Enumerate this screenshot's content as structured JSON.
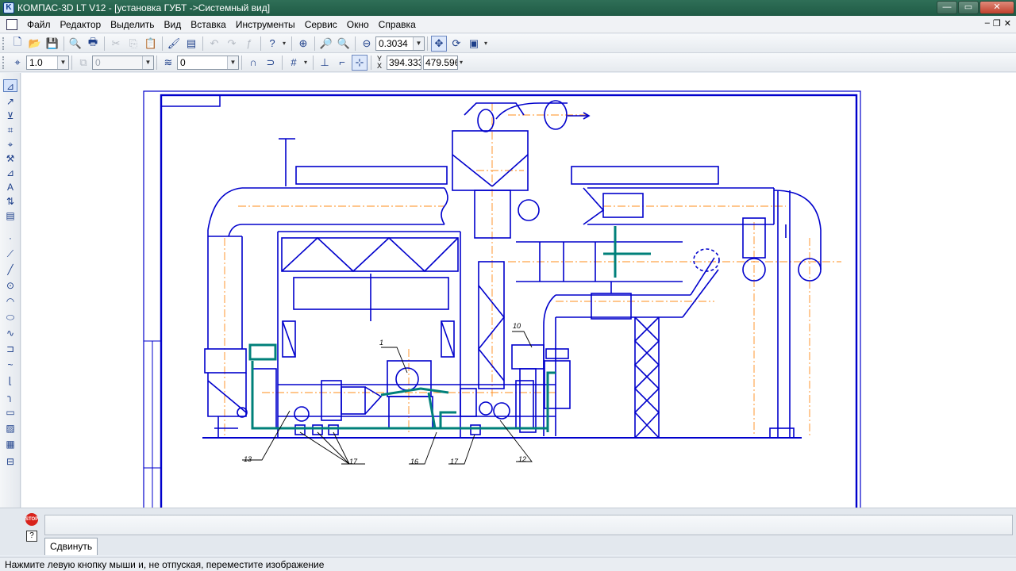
{
  "window": {
    "title": "КОМПАС-3D LT V12 - [установка ГУБТ ->Системный вид]",
    "app_icon": "K",
    "controls": {
      "minimize": "—",
      "maximize": "▭",
      "close": "✕"
    }
  },
  "menu": {
    "items": [
      "Файл",
      "Редактор",
      "Выделить",
      "Вид",
      "Вставка",
      "Инструменты",
      "Сервис",
      "Окно",
      "Справка"
    ],
    "mdi": {
      "minimize": "–",
      "restore": "❐",
      "close": "✕"
    }
  },
  "toolbar_standard": {
    "zoom_value": "0.3034"
  },
  "toolbar_current_state": {
    "step_value": "1.0",
    "layer_value": "0",
    "style_value": "0",
    "coord_label": "Y X",
    "coord_x": "394.333",
    "coord_y": "479.596"
  },
  "drawing": {
    "callouts": [
      "1",
      "10",
      "13",
      "17",
      "16",
      "17",
      "12"
    ]
  },
  "bottom": {
    "stop_label": "STOP",
    "help_label": "?",
    "tab_label": "Сдвинуть"
  },
  "status": {
    "message": "Нажмите левую кнопку мыши и, не отпуская, переместите изображение"
  },
  "colors": {
    "drawing_line": "#0000cc",
    "axis_line": "#ff8c1a",
    "pipe_teal": "#00807a",
    "title_bar": "#2f6f57"
  }
}
